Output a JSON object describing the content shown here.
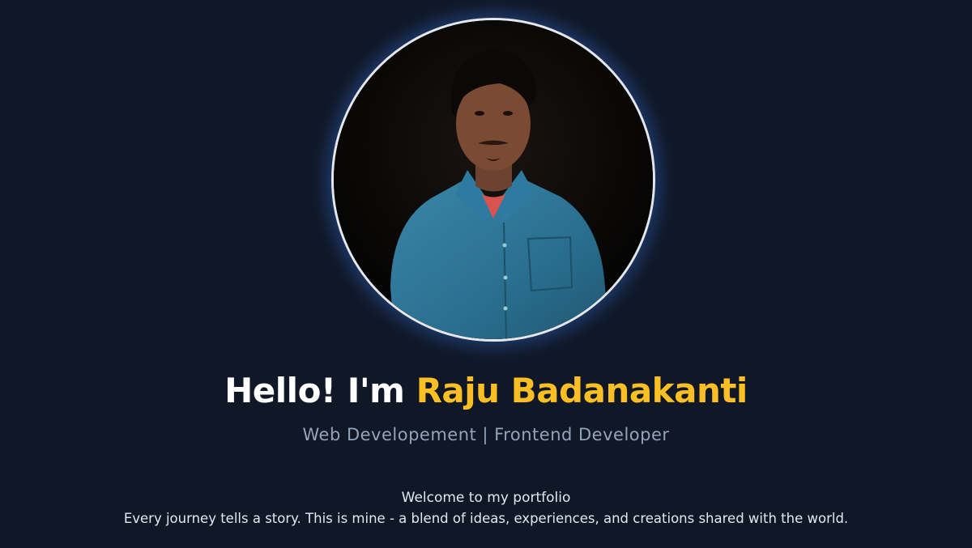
{
  "hero": {
    "greeting": "Hello! I'm",
    "name": "Raju Badanakanti",
    "role": "Web Developement | Frontend Developer",
    "welcome": "Welcome to my portfolio",
    "tagline": "Every journey tells a story. This is mine - a blend of ideas, experiences, and creations shared with the world."
  },
  "colors": {
    "background": "#101828",
    "accent": "#fbbf24",
    "subtitle": "#94a3b8",
    "ring": "#e5e7eb",
    "glow": "#3b82f6"
  },
  "icons": {
    "avatar": "profile-photo"
  }
}
